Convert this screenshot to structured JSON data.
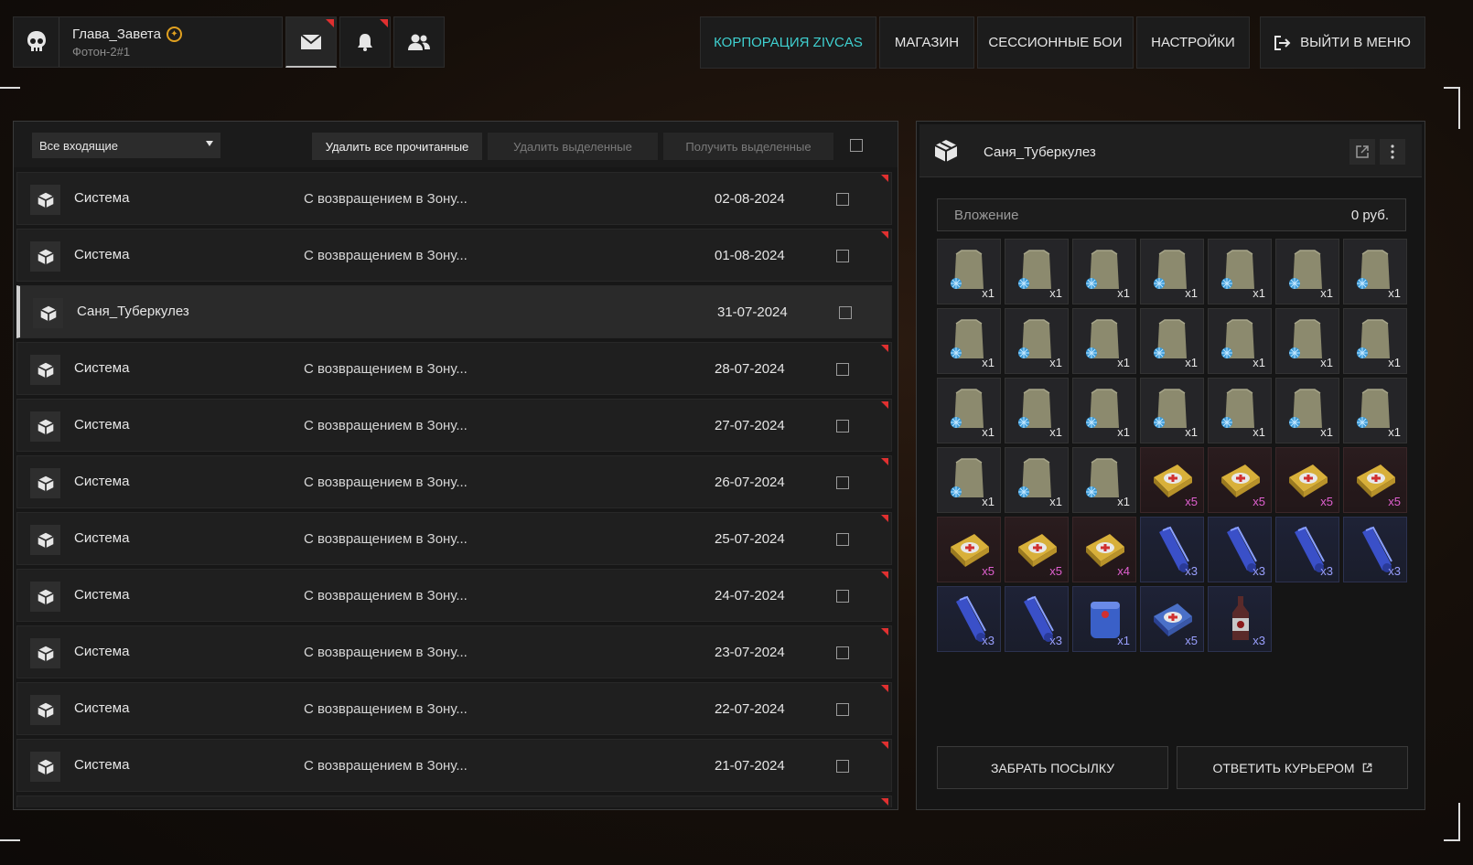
{
  "profile": {
    "name": "Глава_Завета",
    "squad": "Фотон-2#1"
  },
  "nav": {
    "corp": "КОРПОРАЦИЯ ZIVCAS",
    "shop": "МАГАЗИН",
    "battles": "СЕССИОННЫЕ БОИ",
    "settings": "НАСТРОЙКИ",
    "exit": "ВЫЙТИ В МЕНЮ"
  },
  "toolbar": {
    "filter": "Все входящие",
    "delete_read": "Удалить все прочитанные",
    "delete_selected": "Удалить выделенные",
    "receive_selected": "Получить выделенные"
  },
  "mail": [
    {
      "sender": "Система",
      "subject": "С возвращением в Зону...",
      "date": "02-08-2024"
    },
    {
      "sender": "Система",
      "subject": "С возвращением в Зону...",
      "date": "01-08-2024"
    },
    {
      "sender": "Саня_Туберкулез",
      "subject": "",
      "date": "31-07-2024"
    },
    {
      "sender": "Система",
      "subject": "С возвращением в Зону...",
      "date": "28-07-2024"
    },
    {
      "sender": "Система",
      "subject": "С возвращением в Зону...",
      "date": "27-07-2024"
    },
    {
      "sender": "Система",
      "subject": "С возвращением в Зону...",
      "date": "26-07-2024"
    },
    {
      "sender": "Система",
      "subject": "С возвращением в Зону...",
      "date": "25-07-2024"
    },
    {
      "sender": "Система",
      "subject": "С возвращением в Зону...",
      "date": "24-07-2024"
    },
    {
      "sender": "Система",
      "subject": "С возвращением в Зону...",
      "date": "23-07-2024"
    },
    {
      "sender": "Система",
      "subject": "С возвращением в Зону...",
      "date": "22-07-2024"
    },
    {
      "sender": "Система",
      "subject": "С возвращением в Зону...",
      "date": "21-07-2024"
    }
  ],
  "detail": {
    "title": "Саня_Туберкулез",
    "attach_label": "Вложение",
    "attach_value": "0 руб.",
    "items": [
      "x1",
      "x1",
      "x1",
      "x1",
      "x1",
      "x1",
      "x1",
      "x1",
      "x1",
      "x1",
      "x1",
      "x1",
      "x1",
      "x1",
      "x1",
      "x1",
      "x1",
      "x1",
      "x1",
      "x1",
      "x1",
      "x1",
      "x1",
      "x1",
      "x5",
      "x5",
      "x5",
      "x5",
      "x5",
      "x5",
      "x4",
      "x3",
      "x3",
      "x3",
      "x3",
      "x3",
      "x3",
      "x1",
      "x5",
      "x3"
    ],
    "take_button": "ЗАБРАТЬ ПОСЫЛКУ",
    "reply_button": "ОТВЕТИТЬ КУРЬЕРОМ"
  }
}
